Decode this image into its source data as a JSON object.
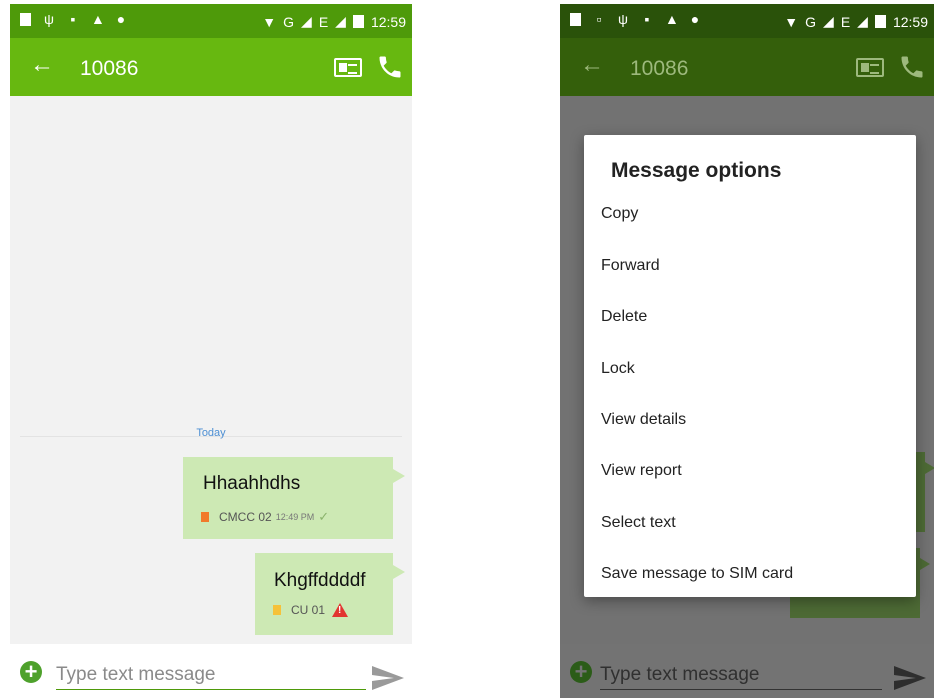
{
  "status_bar": {
    "left_icons": [
      "sd-card-icon",
      "usb-icon",
      "battery-saver-icon",
      "warning-icon",
      "location-icon"
    ],
    "wifi_icon": "wifi-icon",
    "network": "G",
    "network2": "E",
    "time": "12:59"
  },
  "conversation": {
    "contact": "10086",
    "date_separator": "Today",
    "messages": [
      {
        "text": "Hhaahhdhs",
        "sim": "CMCC 02",
        "time": "12:49 PM",
        "status": "delivered"
      },
      {
        "text": "Khgffddddf",
        "sim": "CU 01",
        "status": "failed"
      }
    ]
  },
  "composer": {
    "placeholder": "Type text message"
  },
  "dialog": {
    "title": "Message options",
    "options": [
      "Copy",
      "Forward",
      "Delete",
      "Lock",
      "View details",
      "View report",
      "Select text",
      "Save message to SIM card"
    ]
  },
  "colors": {
    "status_bar": "#4e9a0a",
    "toolbar": "#67b810",
    "bubble": "#cde9b4",
    "date_text": "#4d8fd3",
    "error": "#e23530"
  }
}
